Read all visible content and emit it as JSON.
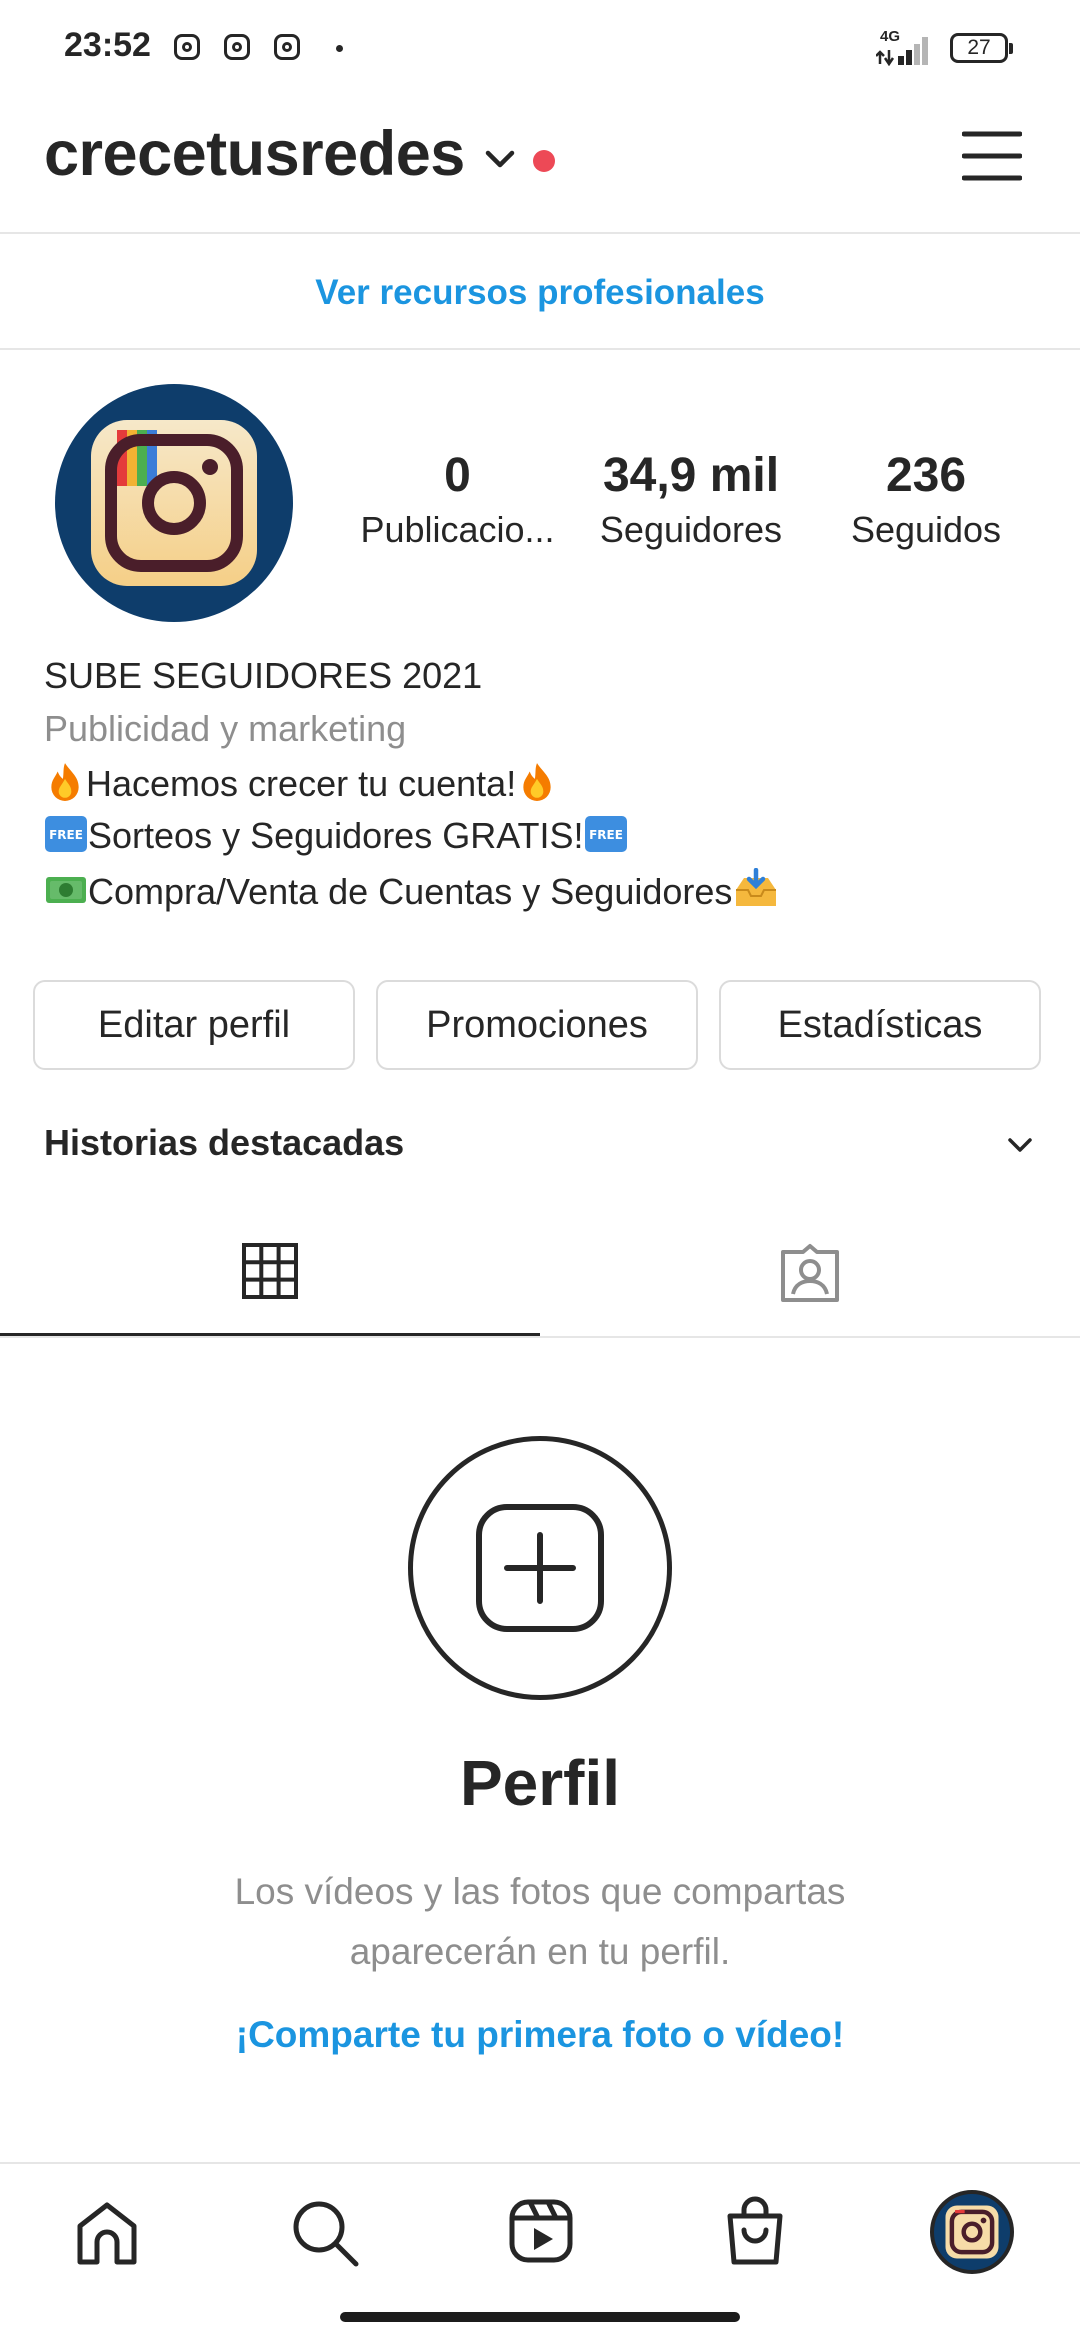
{
  "status_bar": {
    "time": "23:52",
    "network": "4G",
    "battery": "27"
  },
  "header": {
    "username": "crecetusredes"
  },
  "pro_link": "Ver recursos profesionales",
  "stats": [
    {
      "value": "0",
      "label": "Publicacio..."
    },
    {
      "value": "34,9 mil",
      "label": "Seguidores"
    },
    {
      "value": "236",
      "label": "Seguidos"
    }
  ],
  "bio": {
    "name": "SUBE SEGUIDORES 2021",
    "category": "Publicidad y marketing",
    "lines": [
      "Hacemos crecer tu cuenta!",
      "Sorteos y Seguidores GRATIS!",
      "Compra/Venta de Cuentas y Seguidores"
    ],
    "free_badge": "FREE"
  },
  "buttons": {
    "edit": "Editar perfil",
    "promotions": "Promociones",
    "insights": "Estadísticas"
  },
  "highlights": {
    "title": "Historias destacadas"
  },
  "empty_state": {
    "title": "Perfil",
    "description": "Los vídeos y las fotos que compartas aparecerán en tu perfil.",
    "cta": "¡Comparte tu primera foto o vídeo!"
  },
  "icons": {
    "grid_tab": "grid-icon",
    "tagged_tab": "tagged-icon",
    "menu": "hamburger-menu-icon",
    "nav": [
      "home-icon",
      "search-icon",
      "reels-icon",
      "shop-icon",
      "profile-avatar"
    ]
  },
  "colors": {
    "link": "#1b95e0",
    "notification": "#ed4956",
    "avatar_bg": "#0e3d6b"
  }
}
